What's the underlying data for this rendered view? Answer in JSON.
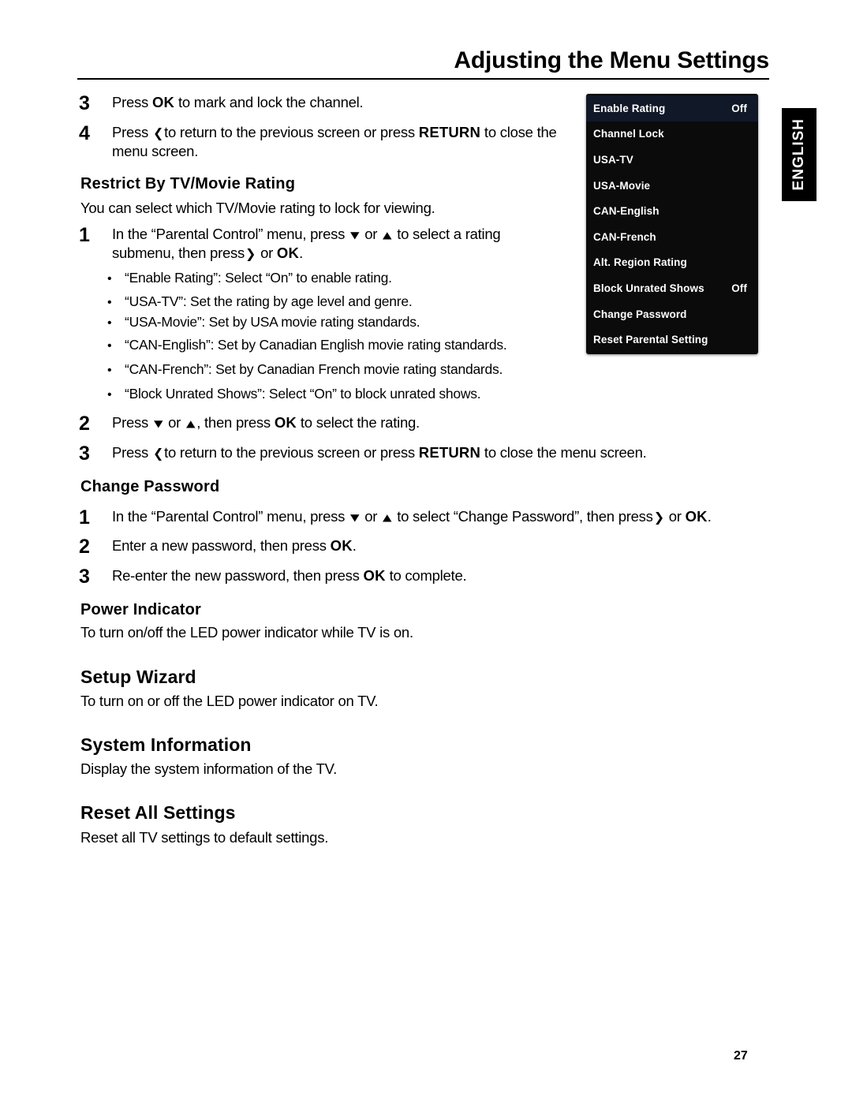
{
  "header": {
    "title": "Adjusting the Menu Settings"
  },
  "language_tab": {
    "label": "ENGLISH"
  },
  "osd_menu": {
    "name": "Parental Control",
    "rows": [
      {
        "label": "Enable Rating",
        "value": "Off",
        "selected": true
      },
      {
        "label": "Channel Lock",
        "value": "",
        "selected": false
      },
      {
        "label": "USA-TV",
        "value": "",
        "selected": false
      },
      {
        "label": "USA-Movie",
        "value": "",
        "selected": false
      },
      {
        "label": "CAN-English",
        "value": "",
        "selected": false
      },
      {
        "label": "CAN-French",
        "value": "",
        "selected": false
      },
      {
        "label": "Alt. Region Rating",
        "value": "",
        "selected": false
      },
      {
        "label": "Block Unrated Shows",
        "value": "Off",
        "selected": false
      },
      {
        "label": "Change Password",
        "value": "",
        "selected": false
      },
      {
        "label": "Reset Parental Setting",
        "value": "",
        "selected": false
      }
    ]
  },
  "steps_top": [
    {
      "num": "3",
      "text_html": "Press <b class=\"kb\">OK</b> to mark and lock the channel."
    },
    {
      "num": "4",
      "text_html": "Press <span class=\"chev\">❮</span>to return to the previous screen or press <b class=\"kb\">RETURN</b> to close the<br>menu screen."
    }
  ],
  "restrict_section": {
    "heading": "Restrict By TV/Movie Rating",
    "intro": "You can select which TV/Movie rating to lock for viewing.",
    "step1": {
      "num": "1",
      "text_html": "In the “Parental Control” menu, press <span class=\"chev-ud\">▼</span> or <span class=\"chev-ud\">▲</span> to select a rating<br>submenu, then press<span class=\"chev\">❯</span> or <b class=\"kb\">OK</b>."
    },
    "bullets": [
      "“Enable Rating”: Select “On” to enable rating.",
      "“USA-TV”: Set the rating by age level and genre.",
      "“USA-Movie”: Set by USA movie rating standards.",
      "“CAN-English”: Set by Canadian English movie rating standards.",
      "“CAN-French”: Set by Canadian French movie rating standards.",
      "“Block Unrated Shows”: Select “On” to block unrated shows."
    ],
    "bullet_marker": "•",
    "step2": {
      "num": "2",
      "text_html": "Press <span class=\"chev-ud\">▼</span> or <span class=\"chev-ud\">▲</span>, then press <b class=\"kb\">OK</b> to select the rating."
    },
    "step3": {
      "num": "3",
      "text_html": "Press <span class=\"chev\">❮</span>to return to the previous screen or press <b class=\"kb\">RETURN</b> to close the menu screen."
    }
  },
  "change_password_section": {
    "heading": "Change Password",
    "steps": [
      {
        "num": "1",
        "text_html": "In the “Parental Control” menu, press <span class=\"chev-ud\">▼</span> or <span class=\"chev-ud\">▲</span> to select “Change Password”, then press<span class=\"chev\">❯</span> or <b class=\"kb\">OK</b>."
      },
      {
        "num": "2",
        "text_html": "Enter a new password, then press <b class=\"kb\">OK</b>."
      },
      {
        "num": "3",
        "text_html": "Re-enter the new password, then press <b class=\"kb\">OK</b> to complete."
      }
    ]
  },
  "power_indicator_section": {
    "heading": "Power Indicator",
    "body": "To turn on/off the LED power indicator while TV is on."
  },
  "setup_wizard_section": {
    "heading": "Setup Wizard",
    "body": "To turn on or off the LED power indicator on TV."
  },
  "system_information_section": {
    "heading": "System Information",
    "body": "Display the system information of the TV."
  },
  "reset_all_settings_section": {
    "heading": "Reset All Settings",
    "body": "Reset all TV settings to default settings."
  },
  "footer": {
    "page_number": "27"
  }
}
